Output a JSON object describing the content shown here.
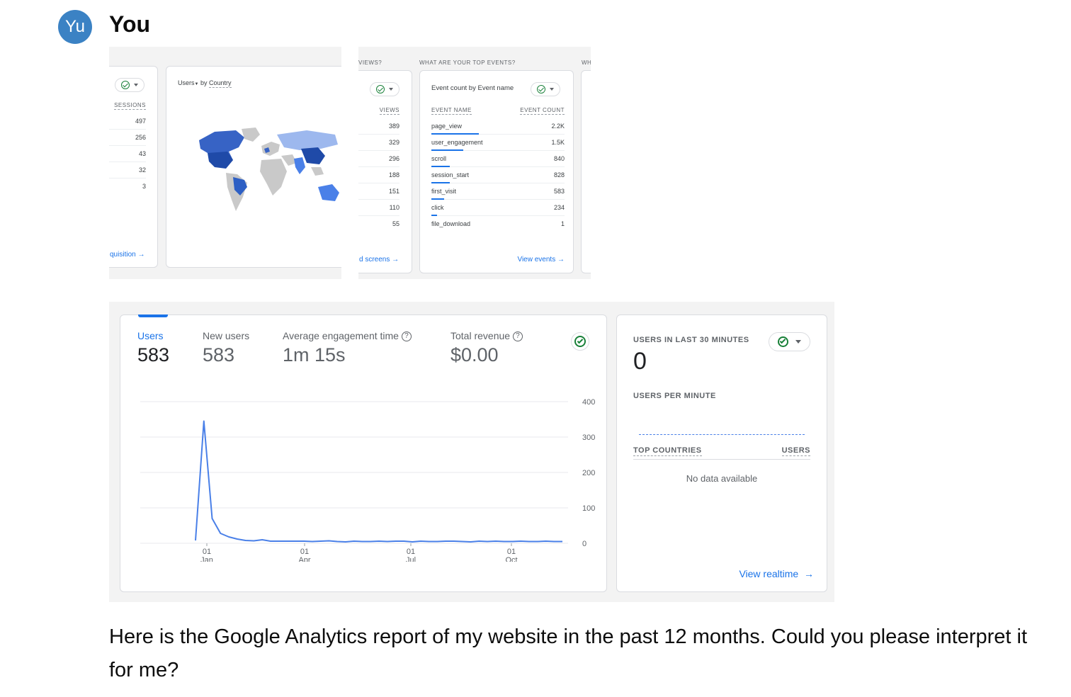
{
  "author": {
    "initials": "Yu",
    "name": "You"
  },
  "shot1": {
    "sessions_header": "SESSIONS",
    "sessions": [
      "497",
      "256",
      "43",
      "32",
      "3"
    ],
    "acquisition_link": "quisition",
    "map_title_pre": "Users",
    "map_title_by": " by ",
    "map_title_dim": "Country"
  },
  "shot2": {
    "views_question": "VIEWS?",
    "top_events_question": "WHAT ARE YOUR TOP EVENTS?",
    "next_question": "WH",
    "views_header": "VIEWS",
    "views": [
      "389",
      "329",
      "296",
      "188",
      "151",
      "110",
      "55"
    ],
    "screens_link": "d screens",
    "events_card_title": "Event count by Event name",
    "event_name_header": "EVENT NAME",
    "event_count_header": "EVENT COUNT",
    "events": [
      {
        "name": "page_view",
        "count": "2.2K"
      },
      {
        "name": "user_engagement",
        "count": "1.5K"
      },
      {
        "name": "scroll",
        "count": "840"
      },
      {
        "name": "session_start",
        "count": "828"
      },
      {
        "name": "first_visit",
        "count": "583"
      },
      {
        "name": "click",
        "count": "234"
      },
      {
        "name": "file_download",
        "count": "1"
      }
    ],
    "view_events_link": "View events"
  },
  "shot3": {
    "metrics": [
      {
        "label": "Users",
        "value": "583"
      },
      {
        "label": "New users",
        "value": "583"
      },
      {
        "label": "Average engagement time",
        "value": "1m 15s"
      },
      {
        "label": "Total revenue",
        "value": "$0.00"
      }
    ],
    "realtime_title": "USERS IN LAST 30 MINUTES",
    "realtime_value": "0",
    "per_minute_label": "USERS PER MINUTE",
    "top_countries_header": "TOP COUNTRIES",
    "users_header": "USERS",
    "no_data": "No data available",
    "view_realtime_link": "View realtime"
  },
  "chart_data": {
    "type": "line",
    "title": "",
    "xlabel": "",
    "ylabel": "",
    "ylim": [
      0,
      400
    ],
    "yticks": [
      "400",
      "300",
      "200",
      "100",
      "0"
    ],
    "xticks": [
      {
        "day": "01",
        "month": "Jan"
      },
      {
        "day": "01",
        "month": "Apr"
      },
      {
        "day": "01",
        "month": "Jul"
      },
      {
        "day": "01",
        "month": "Oct"
      }
    ],
    "series": [
      {
        "values": [
          8,
          345,
          70,
          28,
          18,
          12,
          8,
          7,
          10,
          6,
          6,
          6,
          6,
          6,
          5,
          6,
          7,
          5,
          4,
          6,
          5,
          5,
          6,
          5,
          6,
          6,
          4,
          6,
          5,
          5,
          6,
          6,
          5,
          4,
          6,
          5,
          6,
          5,
          5,
          6,
          5,
          5,
          6,
          5,
          5
        ]
      }
    ],
    "color": "#4a80e8",
    "grid": true
  },
  "message": "Here is the Google Analytics report of my website in the past 12 months. Could you please interpret it for me?"
}
